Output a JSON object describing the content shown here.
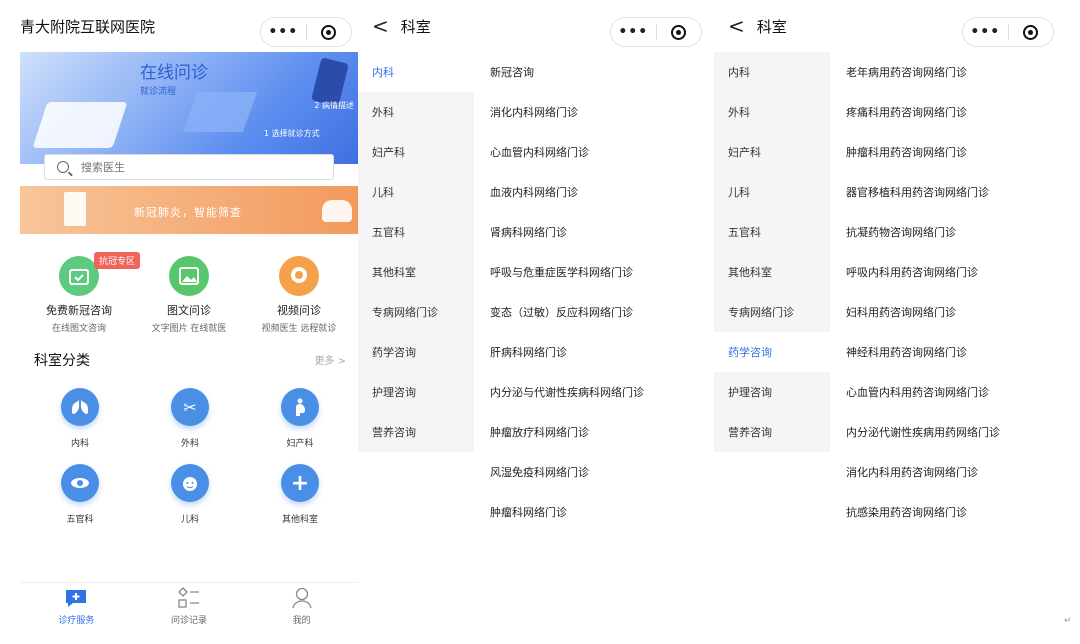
{
  "pane1": {
    "title": "青大附院互联网医院",
    "capsule_more": "•••",
    "banner": {
      "title": "在线问诊",
      "subtitle": "就诊流程",
      "step2": "2 病情描述",
      "step1": "1 选择就诊方式"
    },
    "search_placeholder": "搜索医生",
    "promo_text": "新冠肺炎，智能筛查",
    "badge": "抗冠专区",
    "services": [
      {
        "name": "免费新冠咨询",
        "sub": "在线图文咨询",
        "icon": "calendar-icon",
        "color": "#5ccb7f"
      },
      {
        "name": "图文问诊",
        "sub": "文字图片 在线就医",
        "icon": "image-icon",
        "color": "#58c66d"
      },
      {
        "name": "视频问诊",
        "sub": "视频医生 远程就诊",
        "icon": "camera-icon",
        "color": "#f5a04a"
      }
    ],
    "section_title": "科室分类",
    "section_more": "更多 >",
    "departments": [
      {
        "label": "内科",
        "icon": "lungs-icon"
      },
      {
        "label": "外科",
        "icon": "scissors-icon"
      },
      {
        "label": "妇产科",
        "icon": "pregnant-icon"
      },
      {
        "label": "五官科",
        "icon": "eye-icon"
      },
      {
        "label": "儿科",
        "icon": "baby-icon"
      },
      {
        "label": "其他科室",
        "icon": "plus-icon"
      }
    ],
    "tabs": [
      {
        "label": "诊疗服务",
        "icon": "medical-chat-icon",
        "active": true
      },
      {
        "label": "问诊记录",
        "icon": "list-icon",
        "active": false
      },
      {
        "label": "我的",
        "icon": "user-icon",
        "active": false
      }
    ],
    "accent_color": "#2f73e4"
  },
  "pane2": {
    "back": "<",
    "title": "科室",
    "capsule_more": "•••",
    "categories": [
      "内科",
      "外科",
      "妇产科",
      "儿科",
      "五官科",
      "其他科室",
      "专病网络门诊",
      "药学咨询",
      "护理咨询",
      "营养咨询"
    ],
    "active_category": "内科",
    "items": [
      "新冠咨询",
      "消化内科网络门诊",
      "心血管内科网络门诊",
      "血液内科网络门诊",
      "肾病科网络门诊",
      "呼吸与危重症医学科网络门诊",
      "变态（过敏）反应科网络门诊",
      "肝病科网络门诊",
      "内分泌与代谢性疾病科网络门诊",
      "肿瘤放疗科网络门诊",
      "风湿免疫科网络门诊",
      "肿瘤科网络门诊"
    ]
  },
  "pane3": {
    "back": "<",
    "title": "科室",
    "capsule_more": "•••",
    "categories": [
      "内科",
      "外科",
      "妇产科",
      "儿科",
      "五官科",
      "其他科室",
      "专病网络门诊",
      "药学咨询",
      "护理咨询",
      "营养咨询"
    ],
    "active_category": "药学咨询",
    "items": [
      "老年病用药咨询网络门诊",
      "疼痛科用药咨询网络门诊",
      "肿瘤科用药咨询网络门诊",
      "器官移植科用药咨询网络门诊",
      "抗凝药物咨询网络门诊",
      "呼吸内科用药咨询网络门诊",
      "妇科用药咨询网络门诊",
      "神经科用药咨询网络门诊",
      "心血管内科用药咨询网络门诊",
      "内分泌代谢性疾病用药网络门诊",
      "消化内科用药咨询网络门诊",
      "抗感染用药咨询网络门诊"
    ]
  },
  "corner_mark": "↵"
}
